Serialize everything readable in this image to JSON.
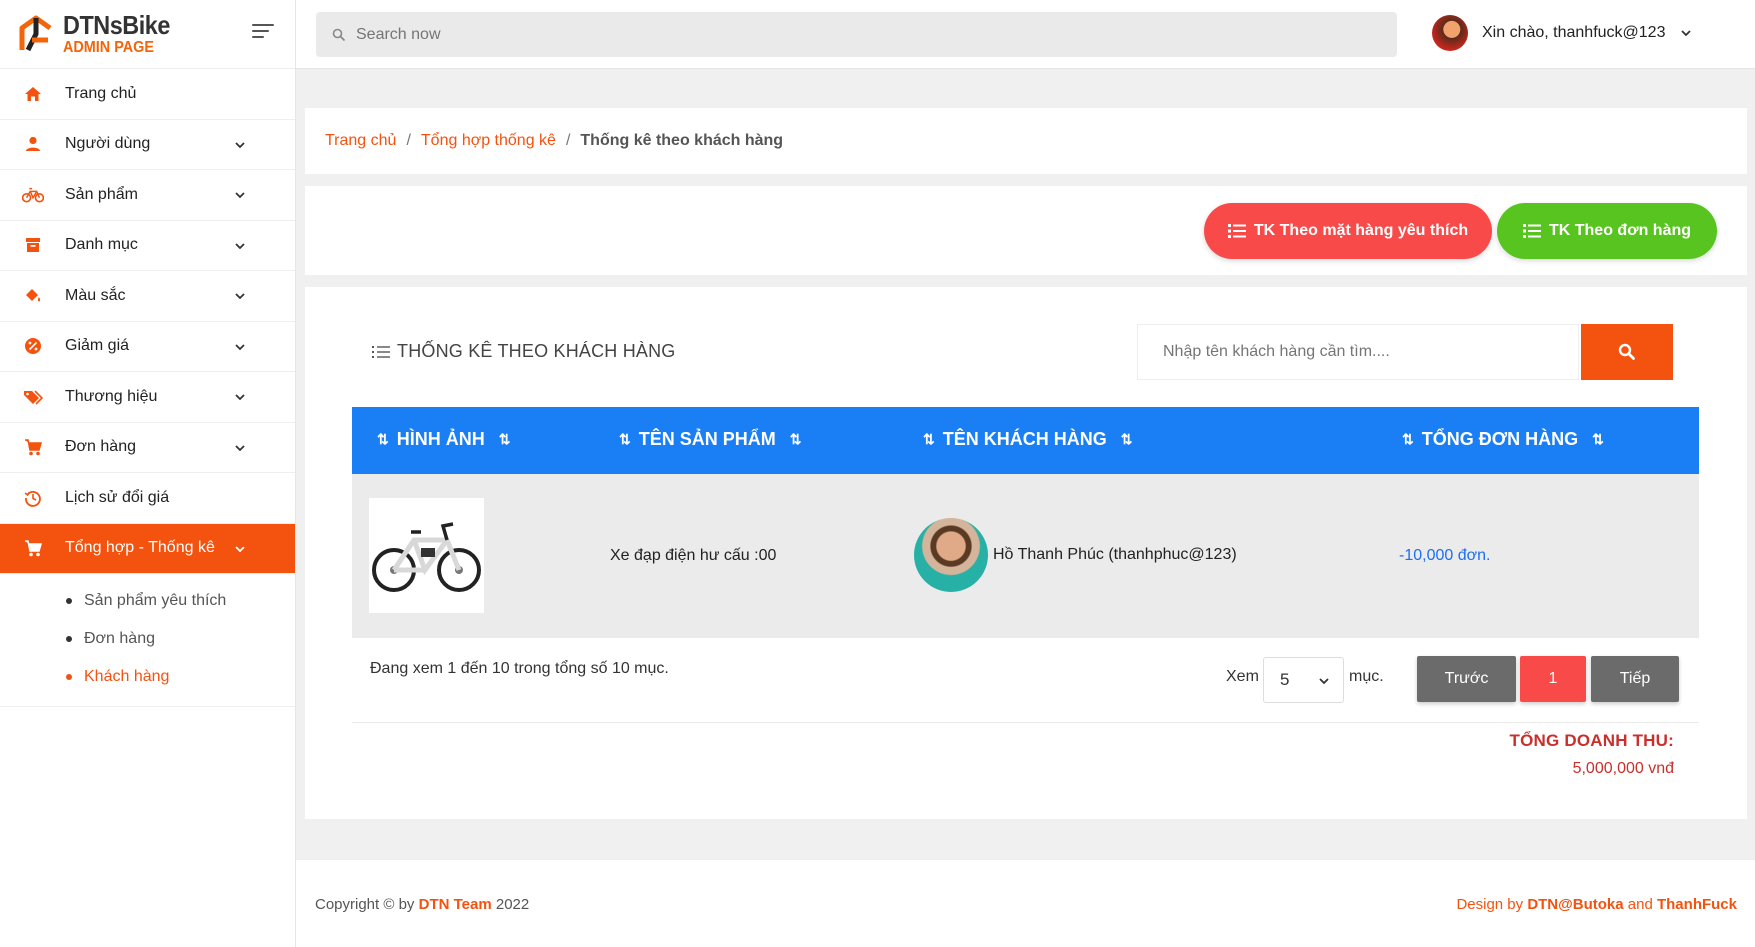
{
  "brand": {
    "name": "DTNsBike",
    "sub": "ADMIN PAGE"
  },
  "topbar": {
    "search_placeholder": "Search now",
    "greeting": "Xin chào, thanhfuck@123"
  },
  "sidebar": {
    "items": [
      {
        "label": "Trang chủ",
        "icon": "home-icon"
      },
      {
        "label": "Người dùng",
        "icon": "user-icon"
      },
      {
        "label": "Sản phẩm",
        "icon": "bicycle-icon"
      },
      {
        "label": "Danh mục",
        "icon": "archive-icon"
      },
      {
        "label": "Màu sắc",
        "icon": "paint-bucket-icon"
      },
      {
        "label": "Giảm giá",
        "icon": "discount-badge-icon"
      },
      {
        "label": "Thương hiệu",
        "icon": "tags-icon"
      },
      {
        "label": "Đơn hàng",
        "icon": "cart-icon"
      },
      {
        "label": "Lịch sử đổi giá",
        "icon": "history-icon"
      },
      {
        "label": "Tổng hợp - Thống kê",
        "icon": "cart-icon"
      }
    ],
    "sub_items": [
      {
        "label": "Sản phẩm yêu thích"
      },
      {
        "label": "Đơn hàng"
      },
      {
        "label": "Khách hàng"
      }
    ]
  },
  "breadcrumb": {
    "home": "Trang chủ",
    "parent": "Tổng hợp thống kê",
    "current": "Thống kê theo khách hàng",
    "sep": "/"
  },
  "actions": {
    "fav_label": "TK Theo mặt hàng yêu thích",
    "order_label": "TK Theo đơn hàng"
  },
  "section": {
    "title": "THỐNG KÊ THEO KHÁCH HÀNG",
    "search_placeholder": "Nhập tên khách hàng cần tìm...."
  },
  "table": {
    "columns": [
      "HÌNH ẢNH",
      "TÊN SẢN PHẨM",
      "TÊN KHÁCH HÀNG",
      "TỔNG ĐƠN HÀNG"
    ],
    "rows": [
      {
        "product": "Xe đạp điện hư cấu :00",
        "customer": "Hồ Thanh Phúc (thanhphuc@123)",
        "total": "-10,000 đơn."
      }
    ]
  },
  "pagination": {
    "showing": "Đang xem 1 đến 10 trong tổng số 10 mục.",
    "xem": "Xem",
    "page_size": "5",
    "muc": "mục.",
    "prev": "Trước",
    "current": "1",
    "next": "Tiếp"
  },
  "revenue": {
    "label": "TỔNG DOANH THU:",
    "value": "5,000,000 vnđ"
  },
  "footer": {
    "copy_prefix": "Copyright © by",
    "team": "DTN Team",
    "year": "2022",
    "design_prefix": "Design by",
    "author1": "DTN@Butoka",
    "and": "and",
    "author2": "ThanhFuck"
  },
  "colors": {
    "accent": "#f4520f",
    "table_header": "#1a7ff5",
    "fav_button": "#f94a4a",
    "order_button": "#58c41f"
  }
}
